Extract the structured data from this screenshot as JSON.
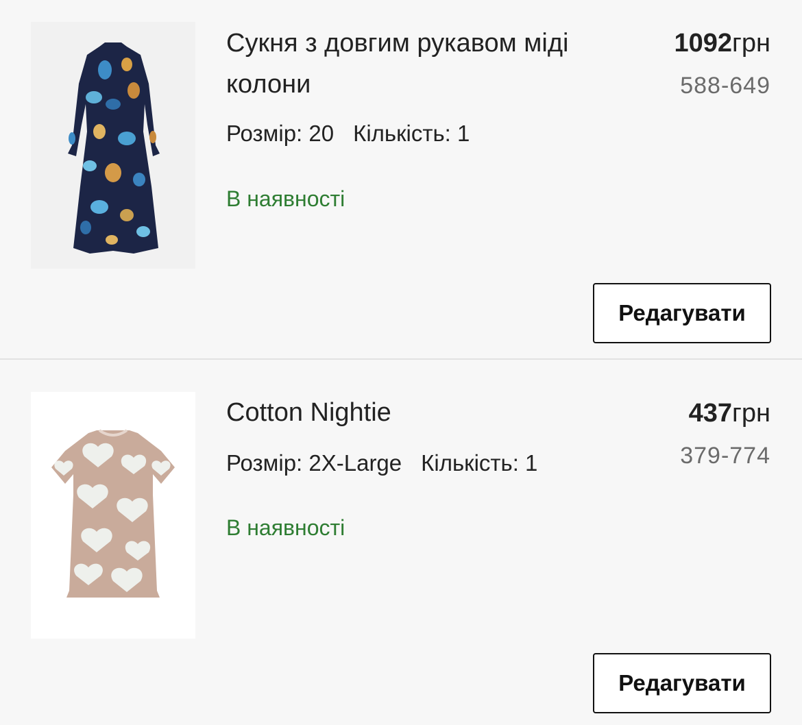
{
  "cart": {
    "items": [
      {
        "title": "Сукня з довгим рукавом міді колони",
        "size_label": "Розмір: 20",
        "quantity_label": "Кількість: 1",
        "stock": "В наявності",
        "price_amount": "1092",
        "price_currency": "грн",
        "sku": "588-649",
        "edit_label": "Редагувати",
        "image": "floral-midi-dress-image"
      },
      {
        "title": "Cotton Nightie",
        "size_label": "Розмір: 2X-Large",
        "quantity_label": "Кількість: 1",
        "stock": "В наявності",
        "price_amount": "437",
        "price_currency": "грн",
        "sku": "379-774",
        "edit_label": "Редагувати",
        "image": "heart-print-nightie-image"
      }
    ]
  },
  "colors": {
    "stock_green": "#2e7d32",
    "background": "#f7f7f7",
    "sku_gray": "#6b6b6b"
  }
}
